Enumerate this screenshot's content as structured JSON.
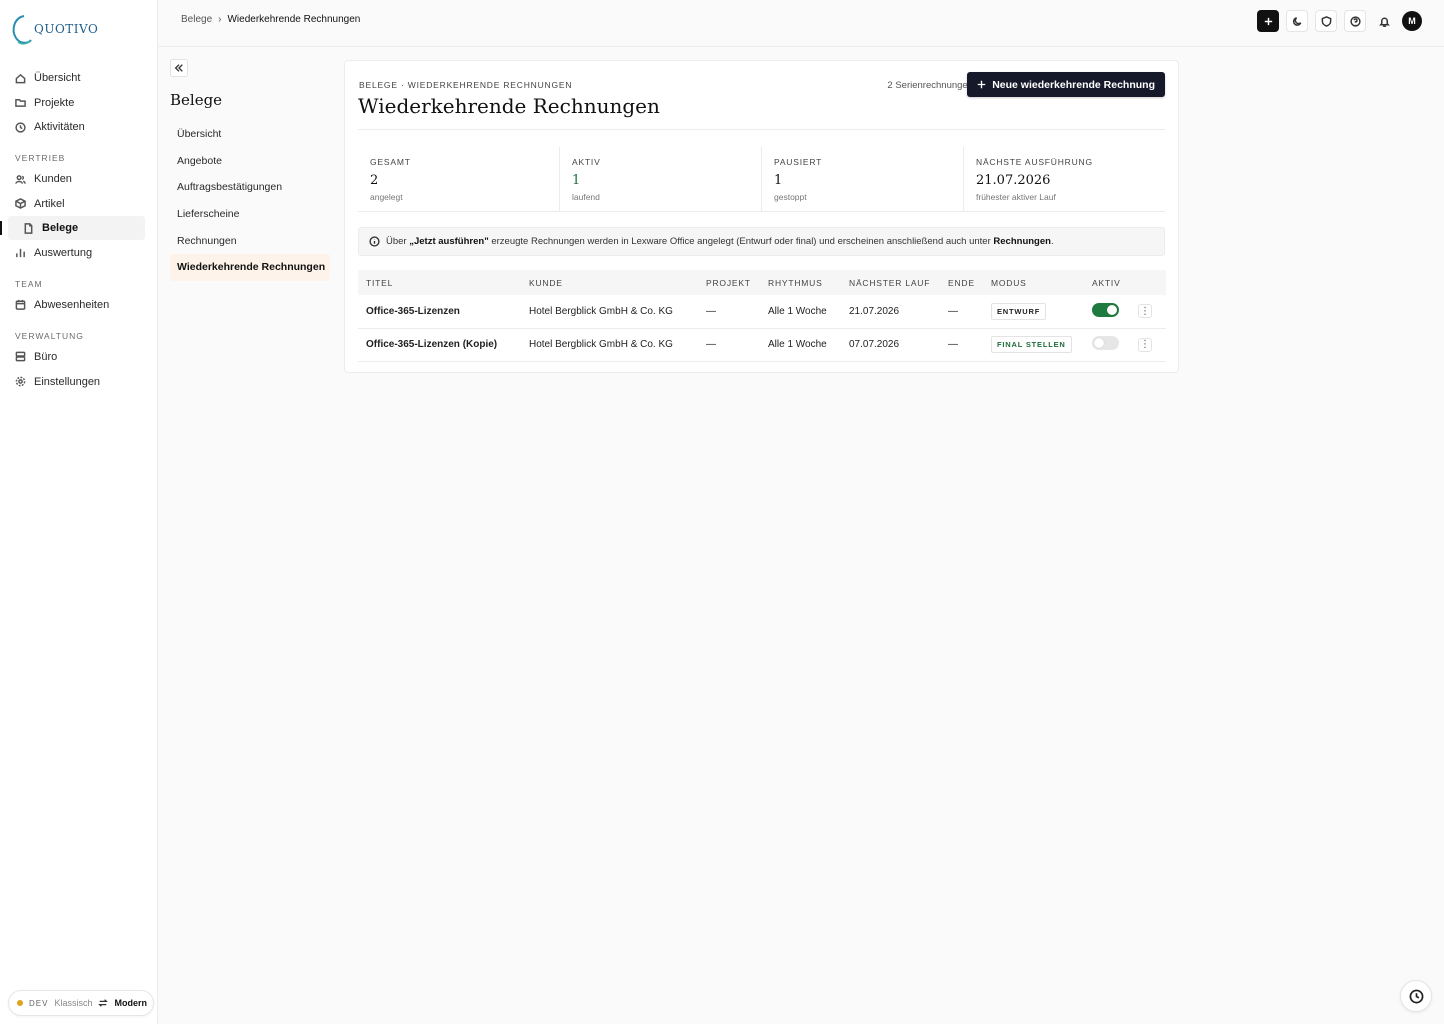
{
  "app": {
    "logo_text": "QUOTIVO",
    "colors": {
      "primary_dark": "#16192a",
      "accent_green": "#1e7a3f",
      "active_bg": "#fdf3ea"
    }
  },
  "sidebar": {
    "items": [
      {
        "label": "Übersicht",
        "icon": "home-icon"
      },
      {
        "label": "Projekte",
        "icon": "folder-icon"
      },
      {
        "label": "Aktivitäten",
        "icon": "clock-icon"
      }
    ],
    "sections": [
      {
        "title": "VERTRIEB",
        "items": [
          {
            "label": "Kunden",
            "icon": "users-icon"
          },
          {
            "label": "Artikel",
            "icon": "box-icon"
          },
          {
            "label": "Belege",
            "icon": "document-icon",
            "active": true
          },
          {
            "label": "Auswertung",
            "icon": "bar-chart-icon"
          }
        ]
      },
      {
        "title": "TEAM",
        "items": [
          {
            "label": "Abwesenheiten",
            "icon": "calendar-icon"
          }
        ]
      },
      {
        "title": "VERWALTUNG",
        "items": [
          {
            "label": "Büro",
            "icon": "server-icon"
          },
          {
            "label": "Einstellungen",
            "icon": "gear-icon"
          }
        ]
      }
    ],
    "footer": {
      "env": "DEV",
      "classic": "Klassisch",
      "modern": "Modern"
    }
  },
  "topbar": {
    "breadcrumb": {
      "parent": "Belege",
      "separator": "›",
      "current": "Wiederkehrende Rechnungen"
    },
    "avatar_initial": "M"
  },
  "subnav": {
    "title": "Belege",
    "items": [
      {
        "label": "Übersicht"
      },
      {
        "label": "Angebote"
      },
      {
        "label": "Auftragsbestätigungen"
      },
      {
        "label": "Lieferscheine"
      },
      {
        "label": "Rechnungen"
      },
      {
        "label": "Wiederkehrende Rechnungen",
        "active": true
      }
    ]
  },
  "main": {
    "eyebrow": "BELEGE · WIEDERKEHRENDE RECHNUNGEN",
    "title": "Wiederkehrende Rechnungen",
    "count": "2 Serienrechnungen",
    "new_button": "Neue wiederkehrende Rechnung",
    "stats": [
      {
        "label": "GESAMT",
        "value": "2",
        "sub": "angelegt"
      },
      {
        "label": "AKTIV",
        "value": "1",
        "sub": "laufend"
      },
      {
        "label": "PAUSIERT",
        "value": "1",
        "sub": "gestoppt"
      },
      {
        "label": "NÄCHSTE AUSFÜHRUNG",
        "value": "21.07.2026",
        "sub": "frühester aktiver Lauf"
      }
    ],
    "info": {
      "pre": "Über",
      "bold": "„Jetzt ausführen\"",
      "mid": "erzeugte Rechnungen werden in Lexware Office angelegt (Entwurf oder final) und erscheinen anschließend auch unter",
      "link": "Rechnungen",
      "end": "."
    },
    "table": {
      "columns": [
        "TITEL",
        "KUNDE",
        "PROJEKT",
        "RHYTHMUS",
        "NÄCHSTER LAUF",
        "ENDE",
        "MODUS",
        "AKTIV"
      ],
      "rows": [
        {
          "title": "Office-365-Lizenzen",
          "customer": "Hotel Bergblick GmbH & Co. KG",
          "project": "—",
          "rhythm": "Alle 1 Woche",
          "next": "21.07.2026",
          "end": "—",
          "mode": "ENTWURF",
          "active": true
        },
        {
          "title": "Office-365-Lizenzen (Kopie)",
          "customer": "Hotel Bergblick GmbH & Co. KG",
          "project": "—",
          "rhythm": "Alle 1 Woche",
          "next": "07.07.2026",
          "end": "—",
          "mode": "FINAL STELLEN",
          "active": false
        }
      ]
    }
  }
}
